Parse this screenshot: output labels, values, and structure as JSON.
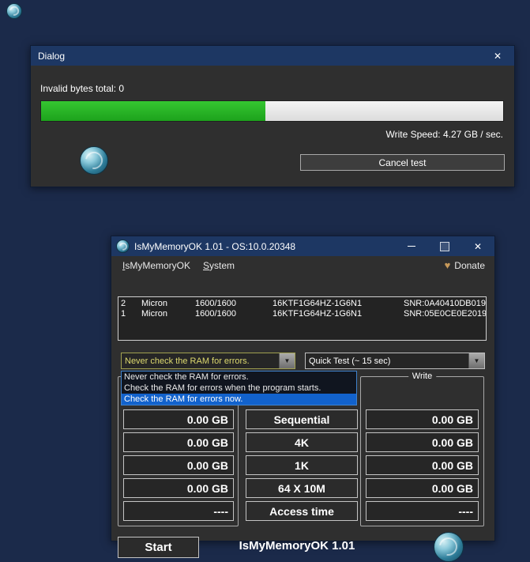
{
  "dialog": {
    "title": "Dialog",
    "invalid_bytes": "Invalid bytes total: 0",
    "progress_percent": 48.5,
    "write_speed": "Write Speed: 4.27 GB / sec.",
    "cancel_label": "Cancel test"
  },
  "app": {
    "title": "IsMyMemoryOK 1.01 - OS:10.0.20348",
    "menu": {
      "items": [
        "IsMyMemoryOK",
        "System"
      ],
      "donate": "Donate"
    },
    "ram_modules": [
      {
        "slot": "2",
        "brand": "Micron",
        "speed": "1600/1600",
        "model": "16KTF1G64HZ-1G6N1",
        "serial": "SNR:0A40410DB019"
      },
      {
        "slot": "1",
        "brand": "Micron",
        "speed": "1600/1600",
        "model": "16KTF1G64HZ-1G6N1",
        "serial": "SNR:05E0CE0E2019"
      }
    ],
    "ram_check_combo": "Never check the RAM for errors.",
    "test_type_combo": "Quick Test (~ 15 sec)",
    "ram_check_options": [
      "Never check the RAM for errors.",
      "Check the RAM for errors when the program starts.",
      "Check the RAM for errors now."
    ],
    "selected_option_index": 2,
    "write_group": "Write",
    "read_values": [
      "0.00 GB",
      "0.00 GB",
      "0.00 GB",
      "0.00 GB",
      "----"
    ],
    "test_buttons": [
      "Sequential",
      "4K",
      "1K",
      "64 X 10M",
      "Access time"
    ],
    "write_values": [
      "0.00 GB",
      "0.00 GB",
      "0.00 GB",
      "0.00 GB",
      "----"
    ],
    "start_label": "Start",
    "footer_title": "IsMyMemoryOK 1.01"
  },
  "glyphs": {
    "close": "✕",
    "dropdown": "▼",
    "donate": "♥"
  }
}
